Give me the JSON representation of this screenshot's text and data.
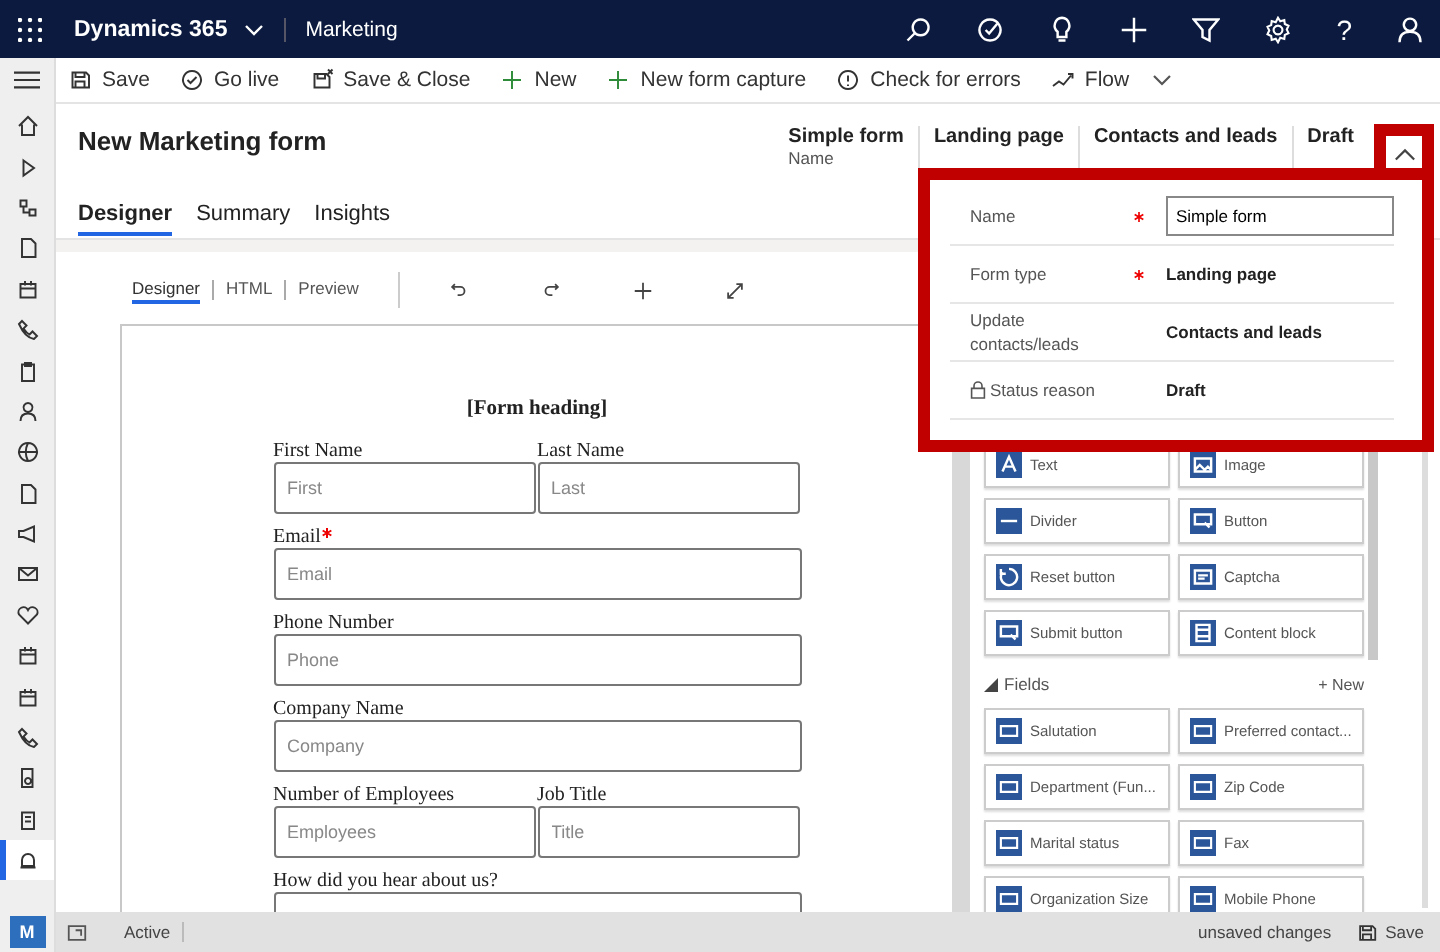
{
  "topbar": {
    "app_name": "Dynamics 365",
    "area": "Marketing",
    "help_glyph": "?"
  },
  "nav_items": [
    {
      "kind": "home",
      "selected": false
    },
    {
      "kind": "play",
      "selected": false
    },
    {
      "kind": "sitemap",
      "selected": false
    },
    {
      "kind": "page",
      "selected": false
    },
    {
      "kind": "calendar",
      "selected": false
    },
    {
      "kind": "phone",
      "selected": false
    },
    {
      "kind": "clipboard",
      "selected": false
    },
    {
      "kind": "person",
      "selected": false
    },
    {
      "kind": "globe",
      "selected": false
    },
    {
      "kind": "page",
      "selected": false
    },
    {
      "kind": "megaphone",
      "selected": false
    },
    {
      "kind": "mail",
      "selected": false
    },
    {
      "kind": "heart",
      "selected": false
    },
    {
      "kind": "calendar",
      "selected": false
    },
    {
      "kind": "calendar",
      "selected": false
    },
    {
      "kind": "phone",
      "selected": false
    },
    {
      "kind": "docsearch",
      "selected": false
    },
    {
      "kind": "form",
      "selected": false
    },
    {
      "kind": "bell",
      "selected": true
    }
  ],
  "user_initial": "M",
  "commands": [
    {
      "label": "Save",
      "kind": "save"
    },
    {
      "label": "Go live",
      "kind": "golive"
    },
    {
      "label": "Save & Close",
      "kind": "saveclose"
    },
    {
      "label": "New",
      "kind": "new"
    },
    {
      "label": "New form capture",
      "kind": "new"
    },
    {
      "label": "Check for errors",
      "kind": "check"
    },
    {
      "label": "Flow",
      "kind": "flow",
      "has_menu": true
    }
  ],
  "record": {
    "title": "New Marketing form",
    "header_fields": [
      {
        "value": "Simple form",
        "label": "Name"
      },
      {
        "value": "Landing page"
      },
      {
        "value": "Contacts and leads"
      },
      {
        "value": "Draft"
      }
    ]
  },
  "tabs": [
    {
      "label": "Designer",
      "selected": true
    },
    {
      "label": "Summary",
      "selected": false
    },
    {
      "label": "Insights",
      "selected": false
    }
  ],
  "designer": {
    "view_tabs": [
      {
        "label": "Designer",
        "selected": true
      },
      {
        "label": "HTML",
        "selected": false
      },
      {
        "label": "Preview",
        "selected": false
      }
    ],
    "form": {
      "heading": "[Form heading]",
      "rows": [
        [
          {
            "label": "First Name",
            "placeholder": "First",
            "required": false,
            "kind": "text"
          },
          {
            "label": "Last Name",
            "placeholder": "Last",
            "required": false,
            "kind": "text"
          }
        ],
        [
          {
            "label": "Email",
            "placeholder": "Email",
            "required": true,
            "kind": "text"
          }
        ],
        [
          {
            "label": "Phone Number",
            "placeholder": "Phone",
            "required": false,
            "kind": "text"
          }
        ],
        [
          {
            "label": "Company Name",
            "placeholder": "Company",
            "required": false,
            "kind": "text"
          }
        ],
        [
          {
            "label": "Number of Employees",
            "placeholder": "Employees",
            "required": false,
            "kind": "text"
          },
          {
            "label": "Job Title",
            "placeholder": "Title",
            "required": false,
            "kind": "text"
          }
        ],
        [
          {
            "label": "How did you hear about us?",
            "required": false,
            "kind": "select"
          }
        ]
      ]
    }
  },
  "toolbox": {
    "elements": [
      {
        "label": "Text",
        "kind": "text"
      },
      {
        "label": "Image",
        "kind": "image"
      },
      {
        "label": "Divider",
        "kind": "divider"
      },
      {
        "label": "Button",
        "kind": "button"
      },
      {
        "label": "Reset button",
        "kind": "reset"
      },
      {
        "label": "Captcha",
        "kind": "captcha"
      },
      {
        "label": "Submit button",
        "kind": "button"
      },
      {
        "label": "Content block",
        "kind": "block"
      }
    ],
    "fields_section": {
      "title": "Fields",
      "expanded": true,
      "new_label": "+ New"
    },
    "fields": [
      {
        "label": "Salutation"
      },
      {
        "label": "Preferred contact..."
      },
      {
        "label": "Department (Fun..."
      },
      {
        "label": "Zip Code"
      },
      {
        "label": "Marital status"
      },
      {
        "label": "Fax"
      },
      {
        "label": "Organization Size"
      },
      {
        "label": "Mobile Phone"
      }
    ]
  },
  "flyout": {
    "rows": [
      {
        "label": "Name",
        "required": true,
        "value": "Simple form",
        "kind": "input",
        "locked": false
      },
      {
        "label": "Form type",
        "required": true,
        "value": "Landing page",
        "kind": "text",
        "locked": false
      },
      {
        "label": "Update contacts/leads",
        "required": false,
        "value": "Contacts and leads",
        "kind": "text",
        "locked": false
      },
      {
        "label": "Status reason",
        "required": false,
        "value": "Draft",
        "kind": "text",
        "locked": true
      }
    ]
  },
  "status_bar": {
    "status": "Active",
    "unsaved": "unsaved changes",
    "save_label": "Save"
  }
}
